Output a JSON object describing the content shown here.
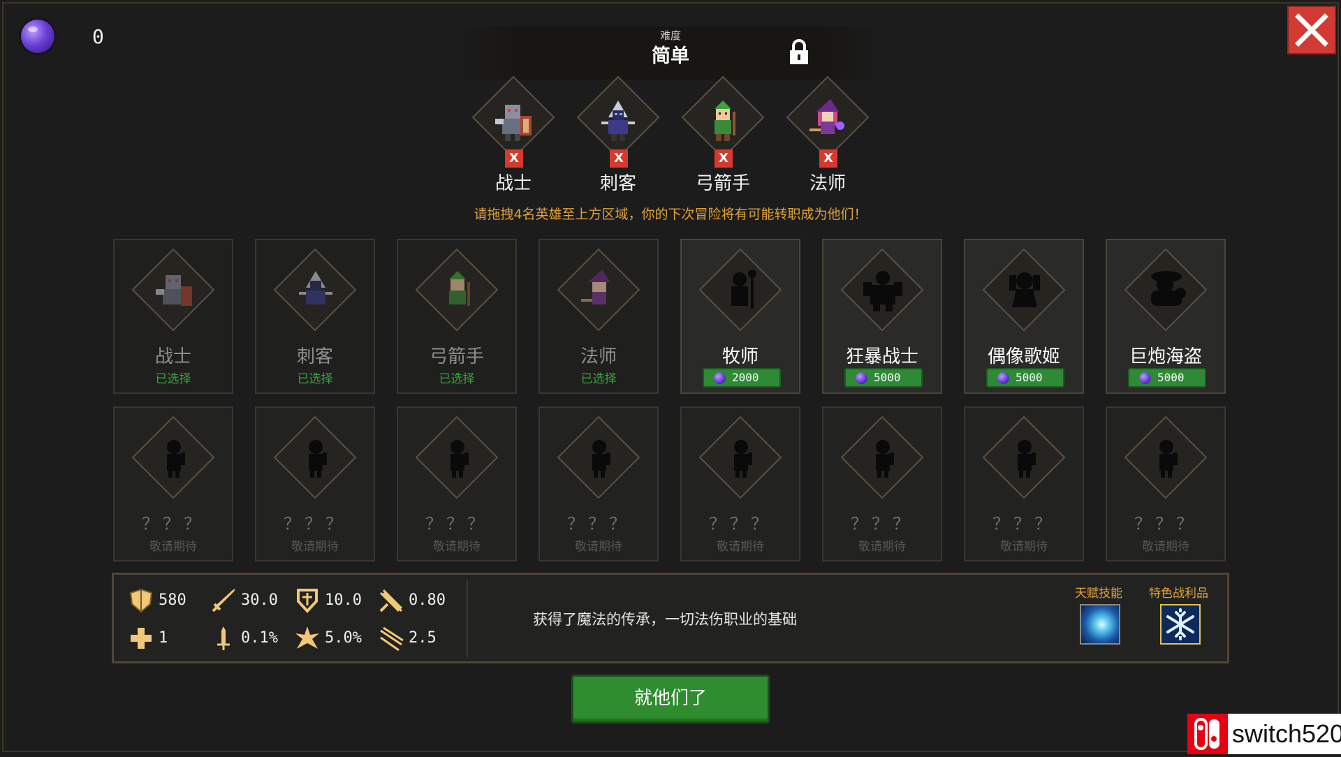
{
  "currency": {
    "icon": "purple-gem-icon",
    "count": "0"
  },
  "difficulty": {
    "label": "难度",
    "value": "简单",
    "icon": "lock-icon"
  },
  "close": {
    "icon": "close-icon"
  },
  "selected": [
    {
      "name": "战士",
      "remove": "X"
    },
    {
      "name": "刺客",
      "remove": "X"
    },
    {
      "name": "弓箭手",
      "remove": "X"
    },
    {
      "name": "法师",
      "remove": "X"
    }
  ],
  "hint": "请拖拽4名英雄至上方区域，你的下次冒险将有可能转职成为他们！",
  "heroes_row1": [
    {
      "name": "战士",
      "status": "已选择"
    },
    {
      "name": "刺客",
      "status": "已选择"
    },
    {
      "name": "弓箭手",
      "status": "已选择"
    },
    {
      "name": "法师",
      "status": "已选择"
    },
    {
      "name": "牧师",
      "price": "2000"
    },
    {
      "name": "狂暴战士",
      "price": "5000"
    },
    {
      "name": "偶像歌姬",
      "price": "5000"
    },
    {
      "name": "巨炮海盗",
      "price": "5000"
    }
  ],
  "heroes_row2": [
    {
      "name": "？？？",
      "status": "敬请期待"
    },
    {
      "name": "？？？",
      "status": "敬请期待"
    },
    {
      "name": "？？？",
      "status": "敬请期待"
    },
    {
      "name": "？？？",
      "status": "敬请期待"
    },
    {
      "name": "？？？",
      "status": "敬请期待"
    },
    {
      "name": "？？？",
      "status": "敬请期待"
    },
    {
      "name": "？？？",
      "status": "敬请期待"
    },
    {
      "name": "？？？",
      "status": "敬请期待"
    }
  ],
  "stats": {
    "hp": "580",
    "attack": "30.0",
    "defense": "10.0",
    "attack_speed": "0.80",
    "regen": "1",
    "crit_rate": "0.1%",
    "crit_damage": "5.0%",
    "range": "2.5"
  },
  "description": "获得了魔法的传承，一切法伤职业的基础",
  "talent": {
    "label": "天赋技能"
  },
  "loot": {
    "label": "特色战利品"
  },
  "confirm": "就他们了",
  "watermark": "switch520",
  "colors": {
    "accent_green": "#2f8c2f",
    "hint_orange": "#e0a23a",
    "close_red": "#d33a33"
  }
}
